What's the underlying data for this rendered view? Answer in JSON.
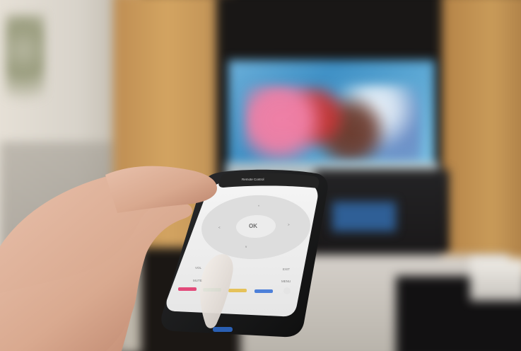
{
  "photo": {
    "subject": "hand-holding-smartphone-remote-app-in-front-of-tv"
  },
  "phone": {
    "screen_header": "Remote Control",
    "dpad": {
      "center_label": "OK",
      "up": "^",
      "down": "v",
      "left": "<",
      "right": ">"
    },
    "small_labels": {
      "left_top": "VOL",
      "right_top": "EXIT",
      "left_mid": "MUTE",
      "right_mid": "MENU"
    },
    "color_buttons": [
      "#e24a7a",
      "#3ebd6a",
      "#e5c25a",
      "#4d80d9"
    ]
  },
  "colors": {
    "cabinet": "#c99b59",
    "tv_screen": "#3f90c5",
    "phone_body": "#141414",
    "phone_screen": "#eeeeee",
    "skin": "#d9a98f"
  }
}
